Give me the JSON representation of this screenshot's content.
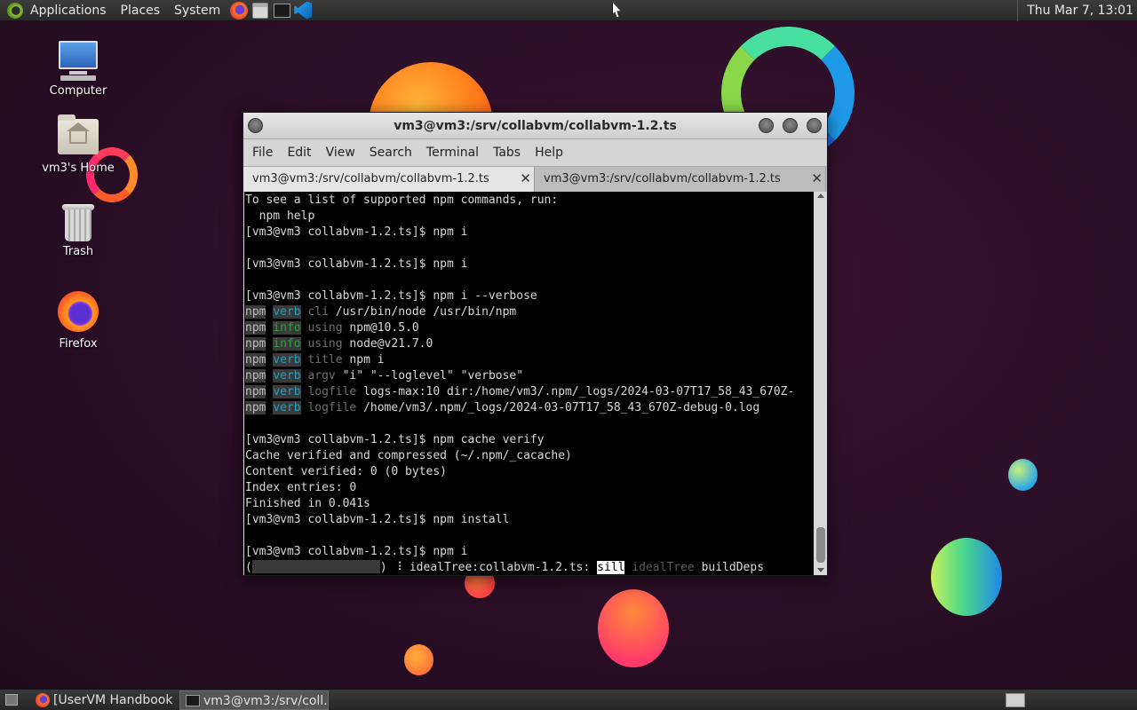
{
  "top_panel": {
    "menus": [
      "Applications",
      "Places",
      "System"
    ],
    "clock": "Thu Mar  7, 13:01"
  },
  "desktop_icons": [
    {
      "label": "Computer"
    },
    {
      "label": "vm3's Home"
    },
    {
      "label": "Trash"
    },
    {
      "label": "Firefox"
    }
  ],
  "window": {
    "title": "vm3@vm3:/srv/collabvm/collabvm-1.2.ts",
    "menus": [
      "File",
      "Edit",
      "View",
      "Search",
      "Terminal",
      "Tabs",
      "Help"
    ],
    "tabs": [
      {
        "label": "vm3@vm3:/srv/collabvm/collabvm-1.2.ts",
        "close": "✕"
      },
      {
        "label": "vm3@vm3:/srv/collabvm/collabvm-1.2.ts",
        "close": "✕"
      }
    ]
  },
  "terminal": {
    "lines": [
      "To see a list of supported npm commands, run:",
      "  npm help",
      "[vm3@vm3 collabvm-1.2.ts]$ npm i",
      "",
      "[vm3@vm3 collabvm-1.2.ts]$ npm i",
      "",
      "[vm3@vm3 collabvm-1.2.ts]$ npm i --verbose"
    ],
    "log": [
      {
        "prefix": "npm",
        "level": "verb",
        "key": "cli",
        "text": " /usr/bin/node /usr/bin/npm"
      },
      {
        "prefix": "npm",
        "level": "info",
        "key": "using",
        "text": " npm@10.5.0"
      },
      {
        "prefix": "npm",
        "level": "info",
        "key": "using",
        "text": " node@v21.7.0"
      },
      {
        "prefix": "npm",
        "level": "verb",
        "key": "title",
        "text": " npm i"
      },
      {
        "prefix": "npm",
        "level": "verb",
        "key": "argv",
        "text": " \"i\" \"--loglevel\" \"verbose\""
      },
      {
        "prefix": "npm",
        "level": "verb",
        "key": "logfile",
        "text": " logs-max:10 dir:/home/vm3/.npm/_logs/2024-03-07T17_58_43_670Z-"
      },
      {
        "prefix": "npm",
        "level": "verb",
        "key": "logfile",
        "text": " /home/vm3/.npm/_logs/2024-03-07T17_58_43_670Z-debug-0.log"
      }
    ],
    "lines2": [
      "",
      "[vm3@vm3 collabvm-1.2.ts]$ npm cache verify",
      "Cache verified and compressed (~/.npm/_cacache)",
      "Content verified: 0 (0 bytes)",
      "Index entries: 0",
      "Finished in 0.041s",
      "[vm3@vm3 collabvm-1.2.ts]$ npm install",
      "",
      "[vm3@vm3 collabvm-1.2.ts]$ npm i"
    ],
    "progress": {
      "open": "(",
      "close": ") ",
      "spinner": "⠸",
      "task": " idealTree:collabvm-1.2.ts: ",
      "level": "sill",
      "key": " idealTree",
      "text": " buildDeps"
    }
  },
  "taskbar": {
    "tasks": [
      {
        "label": "[UserVM Handbook ..."
      },
      {
        "label": "vm3@vm3:/srv/coll..."
      }
    ]
  }
}
